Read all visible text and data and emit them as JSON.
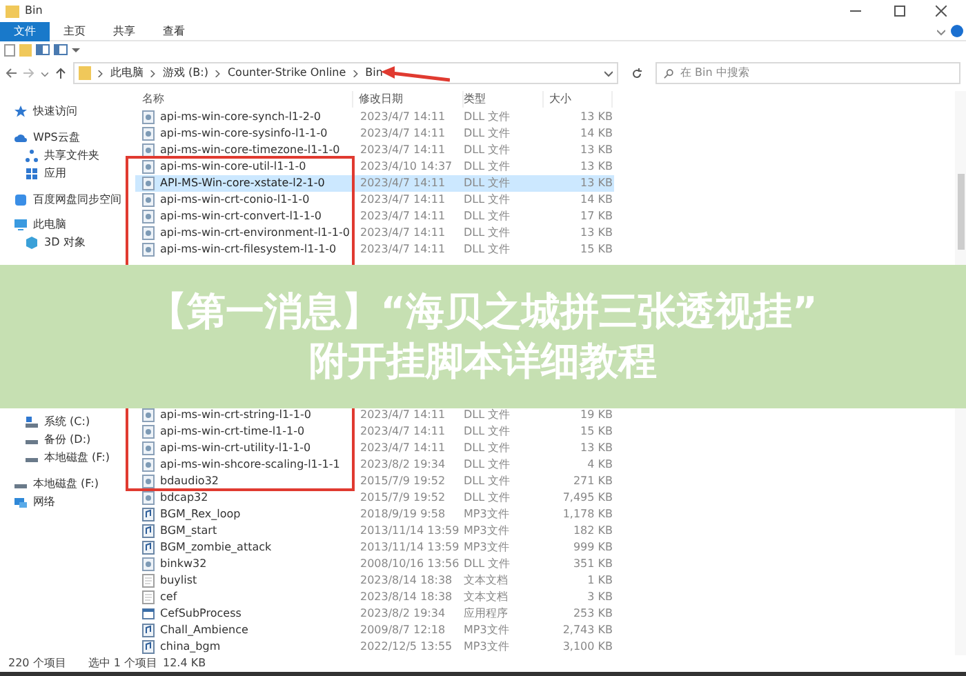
{
  "window": {
    "title": "Bin"
  },
  "ribbon_tabs": [
    {
      "label": "文件",
      "selected": true
    },
    {
      "label": "主页",
      "selected": false
    },
    {
      "label": "共享",
      "selected": false
    },
    {
      "label": "查看",
      "selected": false
    }
  ],
  "address": {
    "path": [
      "此电脑",
      "游戏 (B:)",
      "Counter-Strike Online",
      "Bin"
    ]
  },
  "search": {
    "placeholder": "在 Bin 中搜索"
  },
  "sidebar": {
    "items": [
      {
        "label": "快速访问",
        "kind": "star"
      },
      {
        "label": "WPS云盘",
        "kind": "cloud",
        "children": [
          {
            "label": "共享文件夹",
            "kind": "share"
          },
          {
            "label": "应用",
            "kind": "apps"
          }
        ]
      },
      {
        "label": "百度网盘同步空间",
        "kind": "netdisk"
      },
      {
        "label": "此电脑",
        "kind": "pc",
        "children": [
          {
            "label": "3D 对象",
            "kind": "cube"
          },
          {
            "label": "系统 (C:)",
            "kind": "sysdrive"
          },
          {
            "label": "备份 (D:)",
            "kind": "drive"
          },
          {
            "label": "本地磁盘 (F:)",
            "kind": "drive"
          }
        ]
      },
      {
        "label": "本地磁盘 (F:)",
        "kind": "drive"
      },
      {
        "label": "网络",
        "kind": "network"
      }
    ]
  },
  "table": {
    "columns": [
      "名称",
      "修改日期",
      "类型",
      "大小"
    ],
    "rows_above": [
      {
        "name": "api-ms-win-core-synch-l1-2-0",
        "date": "2023/4/7 14:11",
        "type": "DLL 文件",
        "size": "13 KB",
        "kind": "dll",
        "selected": false
      },
      {
        "name": "api-ms-win-core-sysinfo-l1-1-0",
        "date": "2023/4/7 14:11",
        "type": "DLL 文件",
        "size": "14 KB",
        "kind": "dll",
        "selected": false
      },
      {
        "name": "api-ms-win-core-timezone-l1-1-0",
        "date": "2023/4/7 14:11",
        "type": "DLL 文件",
        "size": "13 KB",
        "kind": "dll",
        "selected": false
      },
      {
        "name": "api-ms-win-core-util-l1-1-0",
        "date": "2023/4/10 14:37",
        "type": "DLL 文件",
        "size": "13 KB",
        "kind": "dll",
        "selected": false
      },
      {
        "name": "API-MS-Win-core-xstate-l2-1-0",
        "date": "2023/4/7 14:11",
        "type": "DLL 文件",
        "size": "13 KB",
        "kind": "dll",
        "selected": true
      },
      {
        "name": "api-ms-win-crt-conio-l1-1-0",
        "date": "2023/4/7 14:11",
        "type": "DLL 文件",
        "size": "14 KB",
        "kind": "dll",
        "selected": false
      },
      {
        "name": "api-ms-win-crt-convert-l1-1-0",
        "date": "2023/4/7 14:11",
        "type": "DLL 文件",
        "size": "17 KB",
        "kind": "dll",
        "selected": false
      },
      {
        "name": "api-ms-win-crt-environment-l1-1-0",
        "date": "2023/4/7 14:11",
        "type": "DLL 文件",
        "size": "13 KB",
        "kind": "dll",
        "selected": false
      },
      {
        "name": "api-ms-win-crt-filesystem-l1-1-0",
        "date": "2023/4/7 14:11",
        "type": "DLL 文件",
        "size": "15 KB",
        "kind": "dll",
        "selected": false
      }
    ],
    "rows_below": [
      {
        "name": "api-ms-win-crt-string-l1-1-0",
        "date": "2023/4/7 14:11",
        "type": "DLL 文件",
        "size": "19 KB",
        "kind": "dll",
        "selected": false
      },
      {
        "name": "api-ms-win-crt-time-l1-1-0",
        "date": "2023/4/7 14:11",
        "type": "DLL 文件",
        "size": "15 KB",
        "kind": "dll",
        "selected": false
      },
      {
        "name": "api-ms-win-crt-utility-l1-1-0",
        "date": "2023/4/7 14:11",
        "type": "DLL 文件",
        "size": "13 KB",
        "kind": "dll",
        "selected": false
      },
      {
        "name": "api-ms-win-shcore-scaling-l1-1-1",
        "date": "2023/8/2 19:34",
        "type": "DLL 文件",
        "size": "4 KB",
        "kind": "dll",
        "selected": false
      },
      {
        "name": "bdaudio32",
        "date": "2015/7/9 19:52",
        "type": "DLL 文件",
        "size": "271 KB",
        "kind": "dll",
        "selected": false
      },
      {
        "name": "bdcap32",
        "date": "2015/7/9 19:52",
        "type": "DLL 文件",
        "size": "7,495 KB",
        "kind": "dll",
        "selected": false
      },
      {
        "name": "BGM_Rex_loop",
        "date": "2018/9/19 9:58",
        "type": "MP3文件",
        "size": "1,178 KB",
        "kind": "mp3",
        "selected": false
      },
      {
        "name": "BGM_start",
        "date": "2013/11/14 13:59",
        "type": "MP3文件",
        "size": "182 KB",
        "kind": "mp3",
        "selected": false
      },
      {
        "name": "BGM_zombie_attack",
        "date": "2013/11/14 13:59",
        "type": "MP3文件",
        "size": "999 KB",
        "kind": "mp3",
        "selected": false
      },
      {
        "name": "binkw32",
        "date": "2008/10/16 13:56",
        "type": "DLL 文件",
        "size": "351 KB",
        "kind": "dll",
        "selected": false
      },
      {
        "name": "buylist",
        "date": "2023/8/14 18:38",
        "type": "文本文档",
        "size": "1 KB",
        "kind": "txt",
        "selected": false
      },
      {
        "name": "cef",
        "date": "2023/8/14 18:38",
        "type": "文本文档",
        "size": "3 KB",
        "kind": "txt",
        "selected": false
      },
      {
        "name": "CefSubProcess",
        "date": "2023/8/2 19:34",
        "type": "应用程序",
        "size": "253 KB",
        "kind": "exe",
        "selected": false
      },
      {
        "name": "Chall_Ambience",
        "date": "2009/8/7 12:18",
        "type": "MP3文件",
        "size": "2,743 KB",
        "kind": "mp3",
        "selected": false
      },
      {
        "name": "china_bgm",
        "date": "2022/12/5 13:55",
        "type": "MP3文件",
        "size": "3,100 KB",
        "kind": "mp3",
        "selected": false
      }
    ]
  },
  "banner": {
    "lines": [
      "【第一消息】“海贝之城拼三张透视挂”",
      "附开挂脚本详细教程"
    ]
  },
  "status_bar": {
    "count": "220 个项目",
    "selection": "选中 1 个项目",
    "selection_size": "12.4 KB"
  }
}
